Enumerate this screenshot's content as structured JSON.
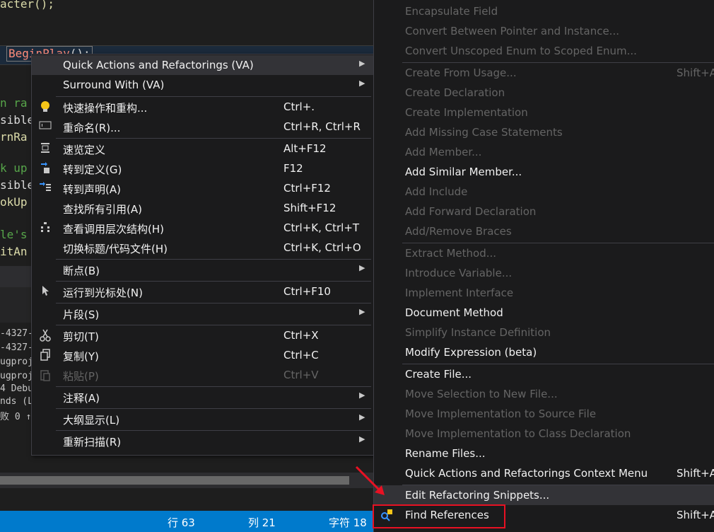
{
  "editor": {
    "lines": [
      {
        "text": "acter();",
        "cls": "fn"
      },
      {
        "text": "n ra",
        "cls": "cm"
      },
      {
        "text": "sible",
        "cls": ""
      },
      {
        "text": "rnRa",
        "cls": "fn"
      },
      {
        "text": "k up",
        "cls": "cm"
      },
      {
        "text": "sible",
        "cls": ""
      },
      {
        "text": "okUp",
        "cls": "fn"
      },
      {
        "text": "le's",
        "cls": "cm"
      },
      {
        "text": "itAn",
        "cls": "fn"
      }
    ],
    "highlight_word": "BeginPlay",
    "highlight_suffix": "();",
    "output_lines": [
      "-4327-",
      "-4327-",
      "ugproj",
      "ugproj",
      "4 Debu",
      "nds (L",
      "败 0 ↑"
    ]
  },
  "status": {
    "line": "行 63",
    "col": "列 21",
    "char": "字符 18"
  },
  "context_menu": {
    "items": [
      {
        "label": "Quick Actions and Refactorings (VA)",
        "shortcut": "",
        "submenu": true,
        "icon": "",
        "hover": true
      },
      {
        "label": "Surround With (VA)",
        "shortcut": "",
        "submenu": true,
        "icon": ""
      },
      {
        "label": "快速操作和重构...",
        "shortcut": "Ctrl+.",
        "icon": "lightbulb-icon"
      },
      {
        "label": "重命名(R)...",
        "shortcut": "Ctrl+R, Ctrl+R",
        "icon": "rename-icon"
      },
      {
        "label": "速览定义",
        "shortcut": "Alt+F12",
        "icon": "peek-definition-icon"
      },
      {
        "label": "转到定义(G)",
        "shortcut": "F12",
        "icon": "go-to-definition-icon"
      },
      {
        "label": "转到声明(A)",
        "shortcut": "Ctrl+F12",
        "icon": "go-to-declaration-icon"
      },
      {
        "label": "查找所有引用(A)",
        "shortcut": "Shift+F12",
        "icon": ""
      },
      {
        "label": "查看调用层次结构(H)",
        "shortcut": "Ctrl+K, Ctrl+T",
        "icon": "call-hierarchy-icon"
      },
      {
        "label": "切换标题/代码文件(H)",
        "shortcut": "Ctrl+K, Ctrl+O",
        "icon": ""
      },
      {
        "label": "断点(B)",
        "shortcut": "",
        "submenu": true,
        "icon": ""
      },
      {
        "label": "运行到光标处(N)",
        "shortcut": "Ctrl+F10",
        "icon": "cursor-icon"
      },
      {
        "label": "片段(S)",
        "shortcut": "",
        "submenu": true,
        "icon": ""
      },
      {
        "label": "剪切(T)",
        "shortcut": "Ctrl+X",
        "icon": "scissors-icon"
      },
      {
        "label": "复制(Y)",
        "shortcut": "Ctrl+C",
        "icon": "copy-icon"
      },
      {
        "label": "粘贴(P)",
        "shortcut": "Ctrl+V",
        "icon": "paste-icon",
        "disabled": true
      },
      {
        "label": "注释(A)",
        "shortcut": "",
        "submenu": true,
        "icon": ""
      },
      {
        "label": "大纲显示(L)",
        "shortcut": "",
        "submenu": true,
        "icon": ""
      },
      {
        "label": "重新扫描(R)",
        "shortcut": "",
        "submenu": true,
        "icon": ""
      }
    ]
  },
  "submenu": {
    "items": [
      {
        "label": "Encapsulate Field",
        "disabled": true
      },
      {
        "label": "Convert Between Pointer and Instance...",
        "disabled": true
      },
      {
        "label": "Convert Unscoped Enum to Scoped Enum...",
        "disabled": true
      },
      {
        "label": "Create From Usage...",
        "disabled": true,
        "shortcut": "Shift+A"
      },
      {
        "label": "Create Declaration",
        "disabled": true
      },
      {
        "label": "Create Implementation",
        "disabled": true
      },
      {
        "label": "Add Missing Case Statements",
        "disabled": true
      },
      {
        "label": "Add Member...",
        "disabled": true
      },
      {
        "label": "Add Similar Member...",
        "disabled": false
      },
      {
        "label": "Add Include",
        "disabled": true
      },
      {
        "label": "Add Forward Declaration",
        "disabled": true
      },
      {
        "label": "Add/Remove Braces",
        "disabled": true
      },
      {
        "label": "Extract Method...",
        "disabled": true
      },
      {
        "label": "Introduce Variable...",
        "disabled": true
      },
      {
        "label": "Implement Interface",
        "disabled": true
      },
      {
        "label": "Document Method",
        "disabled": false
      },
      {
        "label": "Simplify Instance Definition",
        "disabled": true
      },
      {
        "label": "Modify Expression (beta)",
        "disabled": false
      },
      {
        "label": "Create File...",
        "disabled": false
      },
      {
        "label": "Move Selection to New File...",
        "disabled": true
      },
      {
        "label": "Move Implementation to Source File",
        "disabled": true
      },
      {
        "label": "Move Implementation to Class Declaration",
        "disabled": true
      },
      {
        "label": "Rename Files...",
        "disabled": false
      },
      {
        "label": "Quick Actions and Refactorings Context Menu",
        "disabled": false,
        "shortcut": "Shift+A"
      },
      {
        "label": "Edit Refactoring Snippets...",
        "disabled": false,
        "hover": true
      },
      {
        "label": "Find References",
        "disabled": false,
        "shortcut": "Shift+A",
        "icon": "find-references-icon"
      }
    ]
  }
}
